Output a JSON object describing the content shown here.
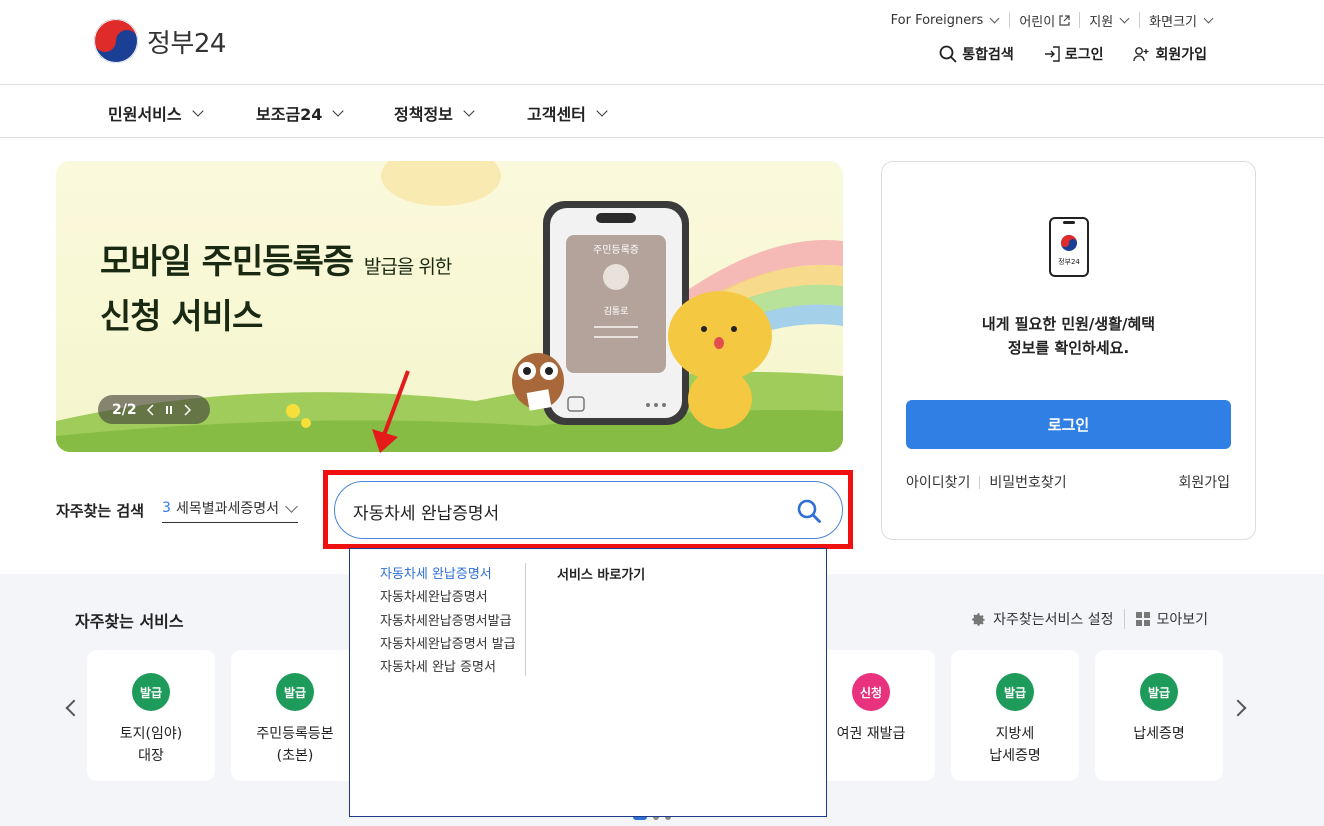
{
  "header": {
    "logo_text": "정부24",
    "utility": [
      {
        "label": "For Foreigners",
        "icon": "chevron-down"
      },
      {
        "label": "어린이",
        "icon": "external-link"
      },
      {
        "label": "지원",
        "icon": "chevron-down"
      },
      {
        "label": "화면크기",
        "icon": "chevron-down"
      }
    ],
    "actions": [
      {
        "label": "통합검색",
        "icon": "search-icon"
      },
      {
        "label": "로그인",
        "icon": "login-icon"
      },
      {
        "label": "회원가입",
        "icon": "user-add-icon"
      }
    ]
  },
  "nav": [
    "민원서비스",
    "보조금24",
    "정책정보",
    "고객센터"
  ],
  "banner": {
    "title_line1": "모바일 주민등록증",
    "title_suffix": "발급을 위한",
    "title_line2": "신청 서비스",
    "page": "2/2",
    "card_title": "주민등록증",
    "card_name": "김통로"
  },
  "login_box": {
    "app_label": "정부24",
    "message_line1": "내게 필요한 민원/생활/혜택",
    "message_line2": "정보를 확인하세요.",
    "login_button": "로그인",
    "find_id": "아이디찾기",
    "find_pw": "비밀번호찾기",
    "join": "회원가입"
  },
  "frequent_search": {
    "label": "자주찾는 검색",
    "rank": "3",
    "keyword": "세목별과세증명서"
  },
  "search": {
    "value": "자동차세 완납증명서"
  },
  "autocomplete": {
    "suggestions": [
      "자동차세 완납증명서",
      "자동차세완납증명서",
      "자동차세완납증명서발급",
      "자동차세완납증명서 발급",
      "자동차세 완납 증명서"
    ],
    "shortcut_title": "서비스 바로가기"
  },
  "frequent_services": {
    "title": "자주찾는 서비스",
    "settings_label": "자주찾는서비스 설정",
    "view_all_label": "모아보기",
    "colors": {
      "issue": "#1e9a5a",
      "apply": "#e8327d"
    },
    "cards": [
      {
        "badge": "발급",
        "name": "토지(임야)\n대장"
      },
      {
        "badge": "발급",
        "name": "주민등록등본\n(초본)"
      },
      {
        "badge": "신청",
        "name": "여권 재발급"
      },
      {
        "badge": "발급",
        "name": "지방세\n납세증명"
      },
      {
        "badge": "발급",
        "name": "납세증명"
      }
    ]
  }
}
